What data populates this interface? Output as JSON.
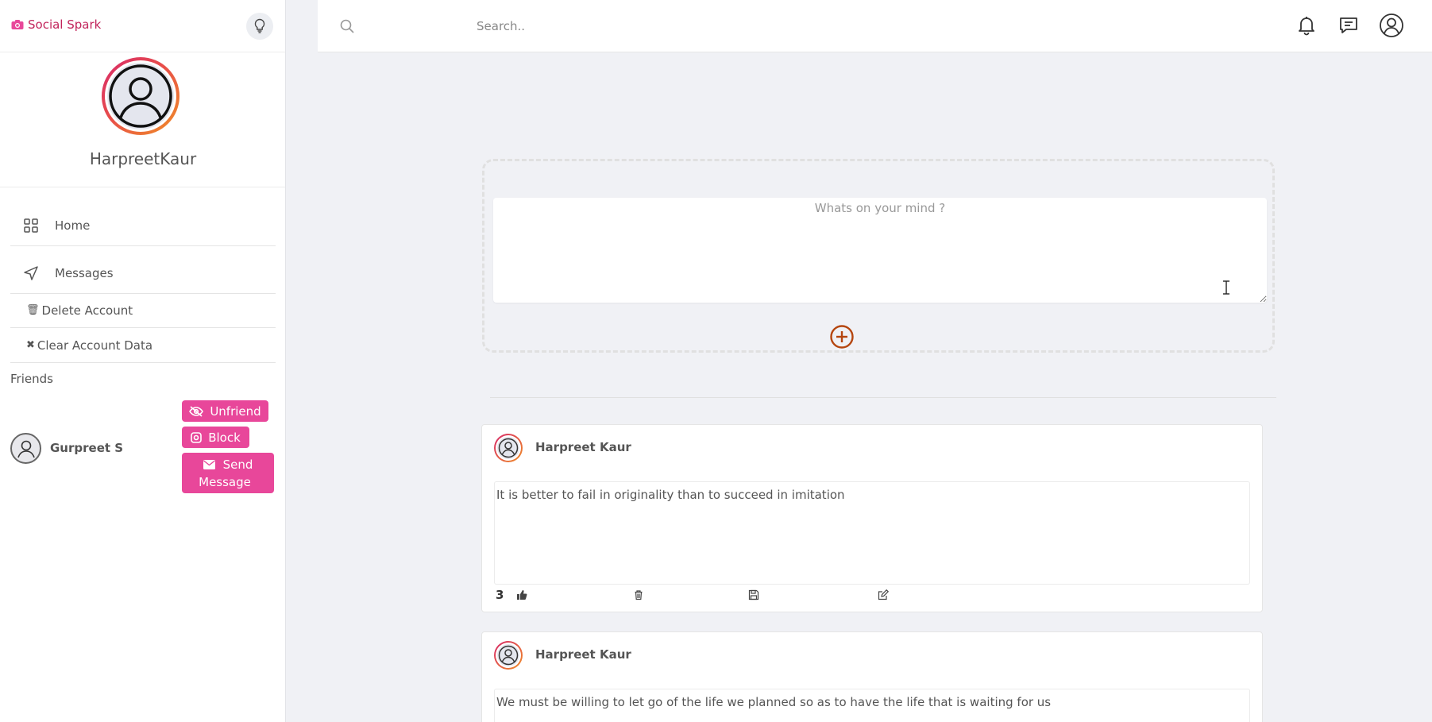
{
  "brand": {
    "name": "Social Spark",
    "color": "#c2255c"
  },
  "profile": {
    "username": "HarpreetKaur"
  },
  "nav": {
    "home_label": "Home",
    "messages_label": "Messages",
    "delete_account_label": "Delete Account",
    "clear_data_label": "Clear Account Data"
  },
  "friends": {
    "section_label": "Friends",
    "items": [
      {
        "name": "Gurpreet S",
        "unfriend_label": "Unfriend",
        "block_label": "Block",
        "send_label_1": "Send",
        "send_label_2": "Message"
      }
    ]
  },
  "search": {
    "placeholder": "Search.."
  },
  "composer": {
    "placeholder": "Whats on your mind ?"
  },
  "posts": [
    {
      "author": "Harpreet Kaur",
      "content": "It is better to fail in originality than to succeed in imitation",
      "likes": "3"
    },
    {
      "author": "Harpreet Kaur",
      "content": "We must be willing to let go of the life we planned so as to have the life that is waiting for us"
    }
  ],
  "colors": {
    "accent_pink": "#e8479a",
    "add_button": "#b5460f",
    "gradient_start": "#d7286b",
    "gradient_end": "#f08f25"
  }
}
